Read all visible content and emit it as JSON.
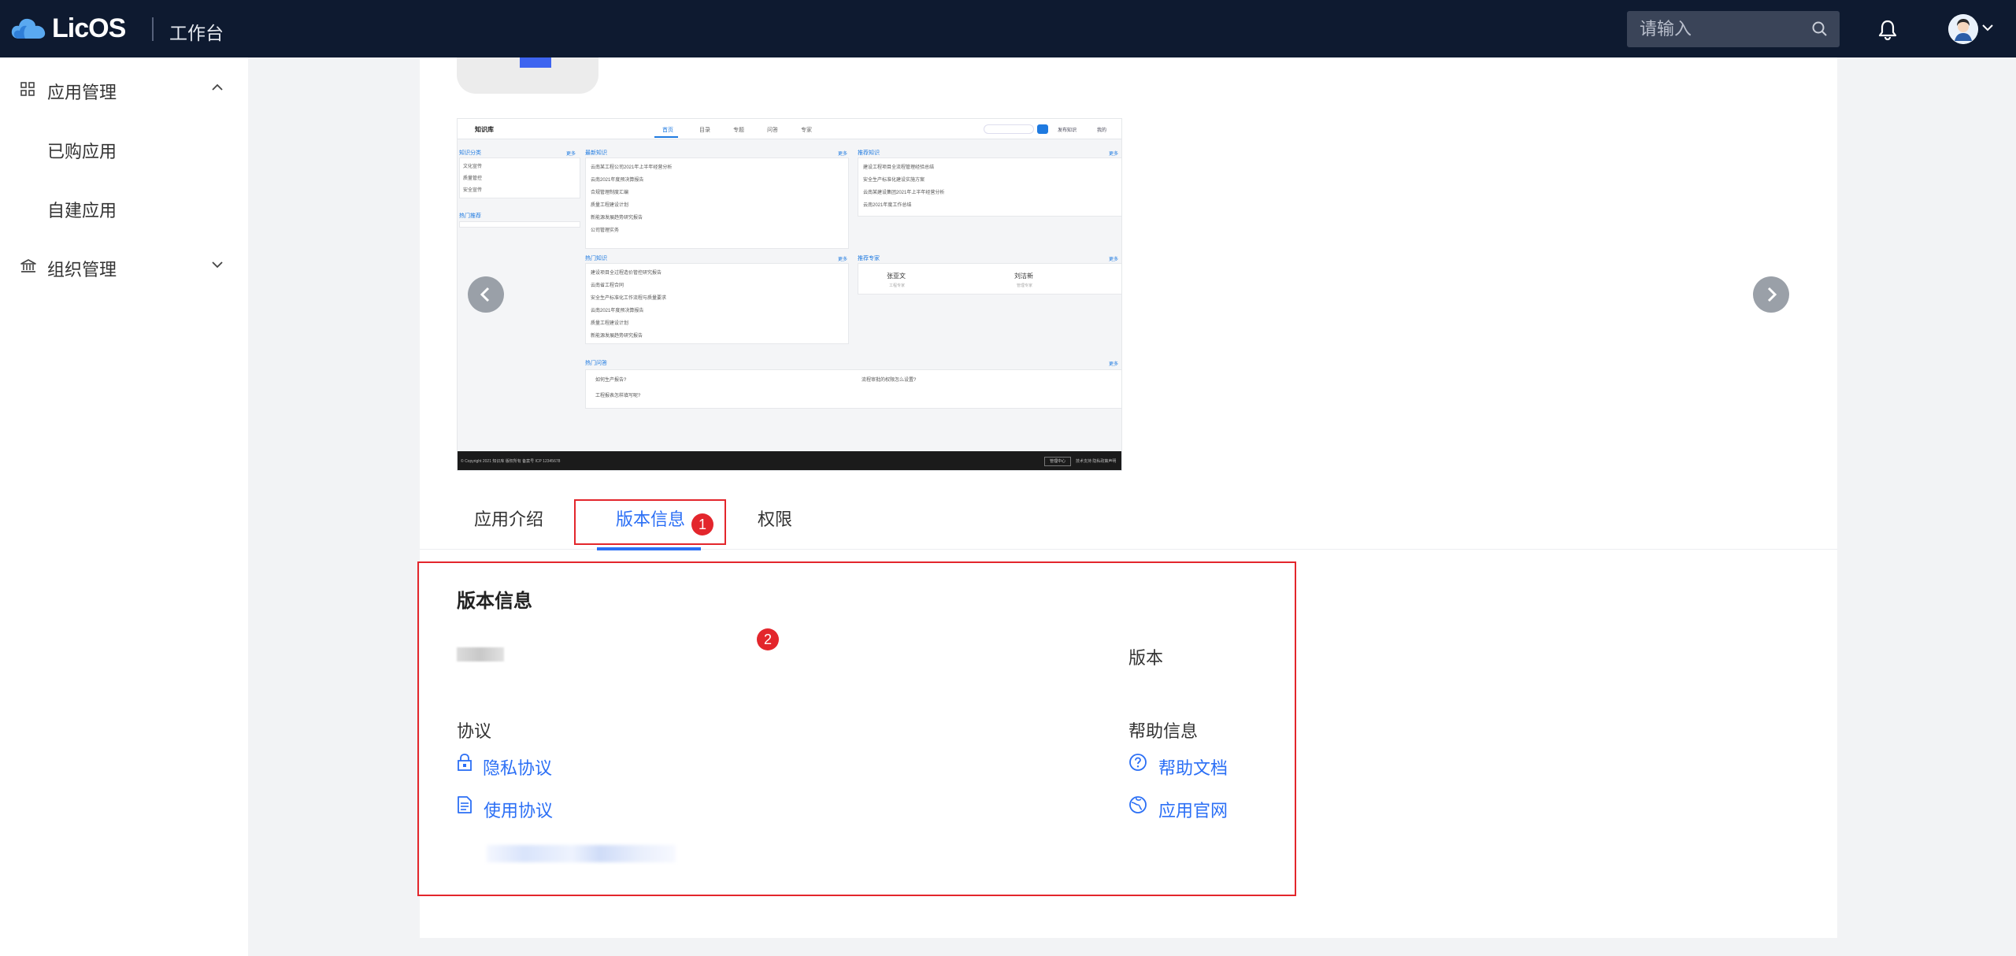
{
  "header": {
    "logo_text": "LicOS",
    "workbench": "工作台",
    "search_placeholder": "请输入"
  },
  "sidebar": {
    "groups": [
      {
        "label": "应用管理",
        "expanded": true,
        "items": [
          {
            "label": "已购应用"
          },
          {
            "label": "自建应用"
          }
        ]
      },
      {
        "label": "组织管理",
        "expanded": false,
        "items": []
      }
    ]
  },
  "preview": {
    "title": "知识库",
    "tabs": [
      "首页",
      "目录",
      "专题",
      "问答",
      "专家"
    ],
    "right_links": [
      "发布知识",
      "我的"
    ],
    "panels": {
      "catalog": {
        "head": "知识分类",
        "more": "更多",
        "items": [
          "文化宣传",
          "质量管控",
          "安全宣传"
        ]
      },
      "hot_tags": {
        "head": "热门推荐"
      },
      "latest": {
        "head": "最新知识",
        "more": "更多",
        "items": [
          "云南某工程公司2021年上半年经营分析",
          "云南2021年度预决算报告",
          "合规管理制度汇编",
          "质量工程建设计划",
          "新能源发展趋势研究报告",
          "公司管理实务"
        ]
      },
      "recommend": {
        "head": "推荐知识",
        "more": "更多",
        "items": [
          "建设工程项目全流程管理经验总结",
          "安全生产标准化建设实施方案",
          "云南某建设集团2021年上半年经营分析",
          "云南2021年度工作总结"
        ]
      },
      "hot": {
        "head": "热门知识",
        "more": "更多",
        "items": [
          "建设项目全过程造价管控研究报告",
          "云南省工程合同",
          "安全生产标准化工作流程与质量要求",
          "云南2021年度预决算报告",
          "质量工程建设计划",
          "新能源发展趋势研究报告"
        ]
      },
      "expert": {
        "head": "推荐专家",
        "more": "更多",
        "people": [
          {
            "name": "张亚文",
            "role": "工程专家"
          },
          {
            "name": "刘洁新",
            "role": "管理专家"
          }
        ]
      },
      "qa": {
        "head": "热门问答",
        "more": "更多",
        "items": [
          "如何生产报告?",
          "流程审批的权限怎么设置?",
          "工程报表怎样填写呢?"
        ]
      }
    },
    "footer_text": "© Copyright 2021 知识库 版权所有 备案号 ICP 12345678",
    "footer_button": "管理中心",
    "footer_right": "技术支持  隐私政策声明"
  },
  "tabs": [
    {
      "label": "应用介绍",
      "active": false
    },
    {
      "label": "版本信息",
      "active": true
    },
    {
      "label": "权限",
      "active": false
    }
  ],
  "annotations": [
    "1",
    "2"
  ],
  "version_info": {
    "title": "版本信息",
    "version_label": "版本",
    "agreement_label": "协议",
    "privacy_link": "隐私协议",
    "usage_link": "使用协议",
    "help_label": "帮助信息",
    "help_doc_link": "帮助文档",
    "official_site_link": "应用官网"
  },
  "colors": {
    "topbar": "#0e1a30",
    "accent": "#2b6ff5",
    "annotation_red": "#e3262c"
  }
}
